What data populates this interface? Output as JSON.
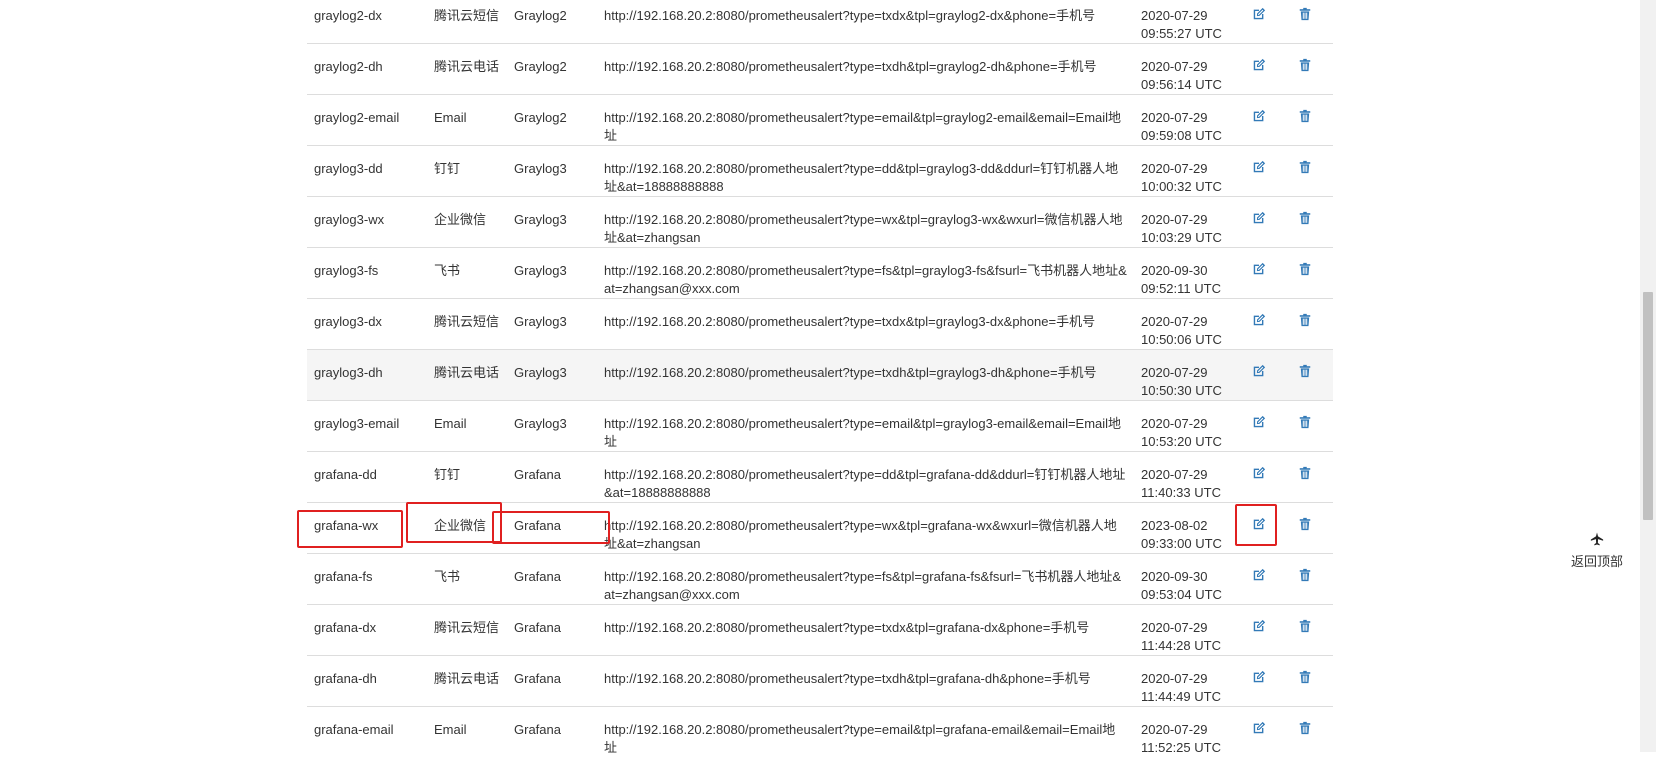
{
  "colors": {
    "icon": "#337ab7",
    "highlight_border": "#e02020",
    "row_hover": "#f5f5f5"
  },
  "rows": [
    {
      "name": "graylog2-dx",
      "type": "腾讯云短信",
      "group": "Graylog2",
      "url": "http://192.168.20.2:8080/prometheusalert?type=txdx&tpl=graylog2-dx&phone=手机号",
      "date": "2020-07-29",
      "time": "09:55:27 UTC"
    },
    {
      "name": "graylog2-dh",
      "type": "腾讯云电话",
      "group": "Graylog2",
      "url": "http://192.168.20.2:8080/prometheusalert?type=txdh&tpl=graylog2-dh&phone=手机号",
      "date": "2020-07-29",
      "time": "09:56:14 UTC"
    },
    {
      "name": "graylog2-email",
      "type": "Email",
      "group": "Graylog2",
      "url": "http://192.168.20.2:8080/prometheusalert?type=email&tpl=graylog2-email&email=Email地址",
      "date": "2020-07-29",
      "time": "09:59:08 UTC"
    },
    {
      "name": "graylog3-dd",
      "type": "钉钉",
      "group": "Graylog3",
      "url": "http://192.168.20.2:8080/prometheusalert?type=dd&tpl=graylog3-dd&ddurl=钉钉机器人地址&at=18888888888",
      "date": "2020-07-29",
      "time": "10:00:32 UTC"
    },
    {
      "name": "graylog3-wx",
      "type": "企业微信",
      "group": "Graylog3",
      "url": "http://192.168.20.2:8080/prometheusalert?type=wx&tpl=graylog3-wx&wxurl=微信机器人地址&at=zhangsan",
      "date": "2020-07-29",
      "time": "10:03:29 UTC"
    },
    {
      "name": "graylog3-fs",
      "type": "飞书",
      "group": "Graylog3",
      "url": "http://192.168.20.2:8080/prometheusalert?type=fs&tpl=graylog3-fs&fsurl=飞书机器人地址&at=zhangsan@xxx.com",
      "date": "2020-09-30",
      "time": "09:52:11 UTC"
    },
    {
      "name": "graylog3-dx",
      "type": "腾讯云短信",
      "group": "Graylog3",
      "url": "http://192.168.20.2:8080/prometheusalert?type=txdx&tpl=graylog3-dx&phone=手机号",
      "date": "2020-07-29",
      "time": "10:50:06 UTC"
    },
    {
      "name": "graylog3-dh",
      "type": "腾讯云电话",
      "group": "Graylog3",
      "url": "http://192.168.20.2:8080/prometheusalert?type=txdh&tpl=graylog3-dh&phone=手机号",
      "date": "2020-07-29",
      "time": "10:50:30 UTC",
      "highlight": true
    },
    {
      "name": "graylog3-email",
      "type": "Email",
      "group": "Graylog3",
      "url": "http://192.168.20.2:8080/prometheusalert?type=email&tpl=graylog3-email&email=Email地址",
      "date": "2020-07-29",
      "time": "10:53:20 UTC"
    },
    {
      "name": "grafana-dd",
      "type": "钉钉",
      "group": "Grafana",
      "url": "http://192.168.20.2:8080/prometheusalert?type=dd&tpl=grafana-dd&ddurl=钉钉机器人地址&at=18888888888",
      "date": "2020-07-29",
      "time": "11:40:33 UTC"
    },
    {
      "name": "grafana-wx",
      "type": "企业微信",
      "group": "Grafana",
      "url": "http://192.168.20.2:8080/prometheusalert?type=wx&tpl=grafana-wx&wxurl=微信机器人地址&at=zhangsan",
      "date": "2023-08-02",
      "time": "09:33:00 UTC"
    },
    {
      "name": "grafana-fs",
      "type": "飞书",
      "group": "Grafana",
      "url": "http://192.168.20.2:8080/prometheusalert?type=fs&tpl=grafana-fs&fsurl=飞书机器人地址&at=zhangsan@xxx.com",
      "date": "2020-09-30",
      "time": "09:53:04 UTC"
    },
    {
      "name": "grafana-dx",
      "type": "腾讯云短信",
      "group": "Grafana",
      "url": "http://192.168.20.2:8080/prometheusalert?type=txdx&tpl=grafana-dx&phone=手机号",
      "date": "2020-07-29",
      "time": "11:44:28 UTC"
    },
    {
      "name": "grafana-dh",
      "type": "腾讯云电话",
      "group": "Grafana",
      "url": "http://192.168.20.2:8080/prometheusalert?type=txdh&tpl=grafana-dh&phone=手机号",
      "date": "2020-07-29",
      "time": "11:44:49 UTC"
    },
    {
      "name": "grafana-email",
      "type": "Email",
      "group": "Grafana",
      "url": "http://192.168.20.2:8080/prometheusalert?type=email&tpl=grafana-email&email=Email地址",
      "date": "2020-07-29",
      "time": "11:52:25 UTC"
    }
  ],
  "edit_icon": "edit-icon",
  "delete_icon": "trash-icon",
  "back_to_top": {
    "label": "返回顶部",
    "icon": "plane-up-icon"
  }
}
